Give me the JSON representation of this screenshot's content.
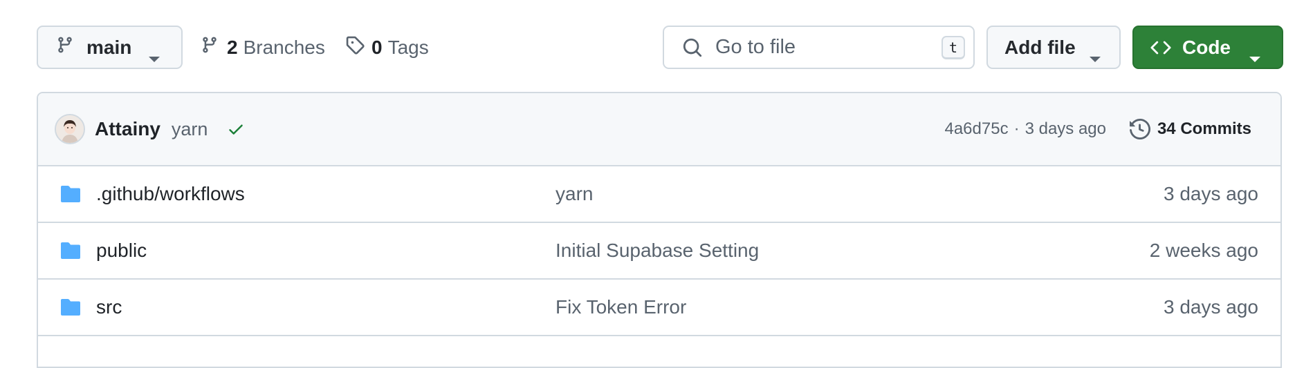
{
  "toolbar": {
    "branch": {
      "name": "main",
      "icon": "git-branch-icon"
    },
    "branches": {
      "count": "2",
      "label": "Branches"
    },
    "tags": {
      "count": "0",
      "label": "Tags"
    },
    "search": {
      "placeholder": "Go to file",
      "value": "",
      "shortcut": "t"
    },
    "add_file_label": "Add file",
    "code_label": "Code",
    "code_button_color": "#2d8138"
  },
  "latest_commit": {
    "author": "Attainy",
    "message": "yarn",
    "status": "success",
    "sha": "4a6d75c",
    "separator": "·",
    "time": "3 days ago",
    "commits_label": "34 Commits"
  },
  "files": [
    {
      "type": "folder",
      "name": ".github/workflows",
      "message": "yarn",
      "age": "3 days ago"
    },
    {
      "type": "folder",
      "name": "public",
      "message": "Initial Supabase Setting",
      "age": "2 weeks ago"
    },
    {
      "type": "folder",
      "name": "src",
      "message": "Fix Token Error",
      "age": "3 days ago"
    }
  ],
  "colors": {
    "folder": "#54aeff",
    "success_check": "#1a7f37",
    "muted_text": "#59636e",
    "border": "#d1d9e0"
  }
}
